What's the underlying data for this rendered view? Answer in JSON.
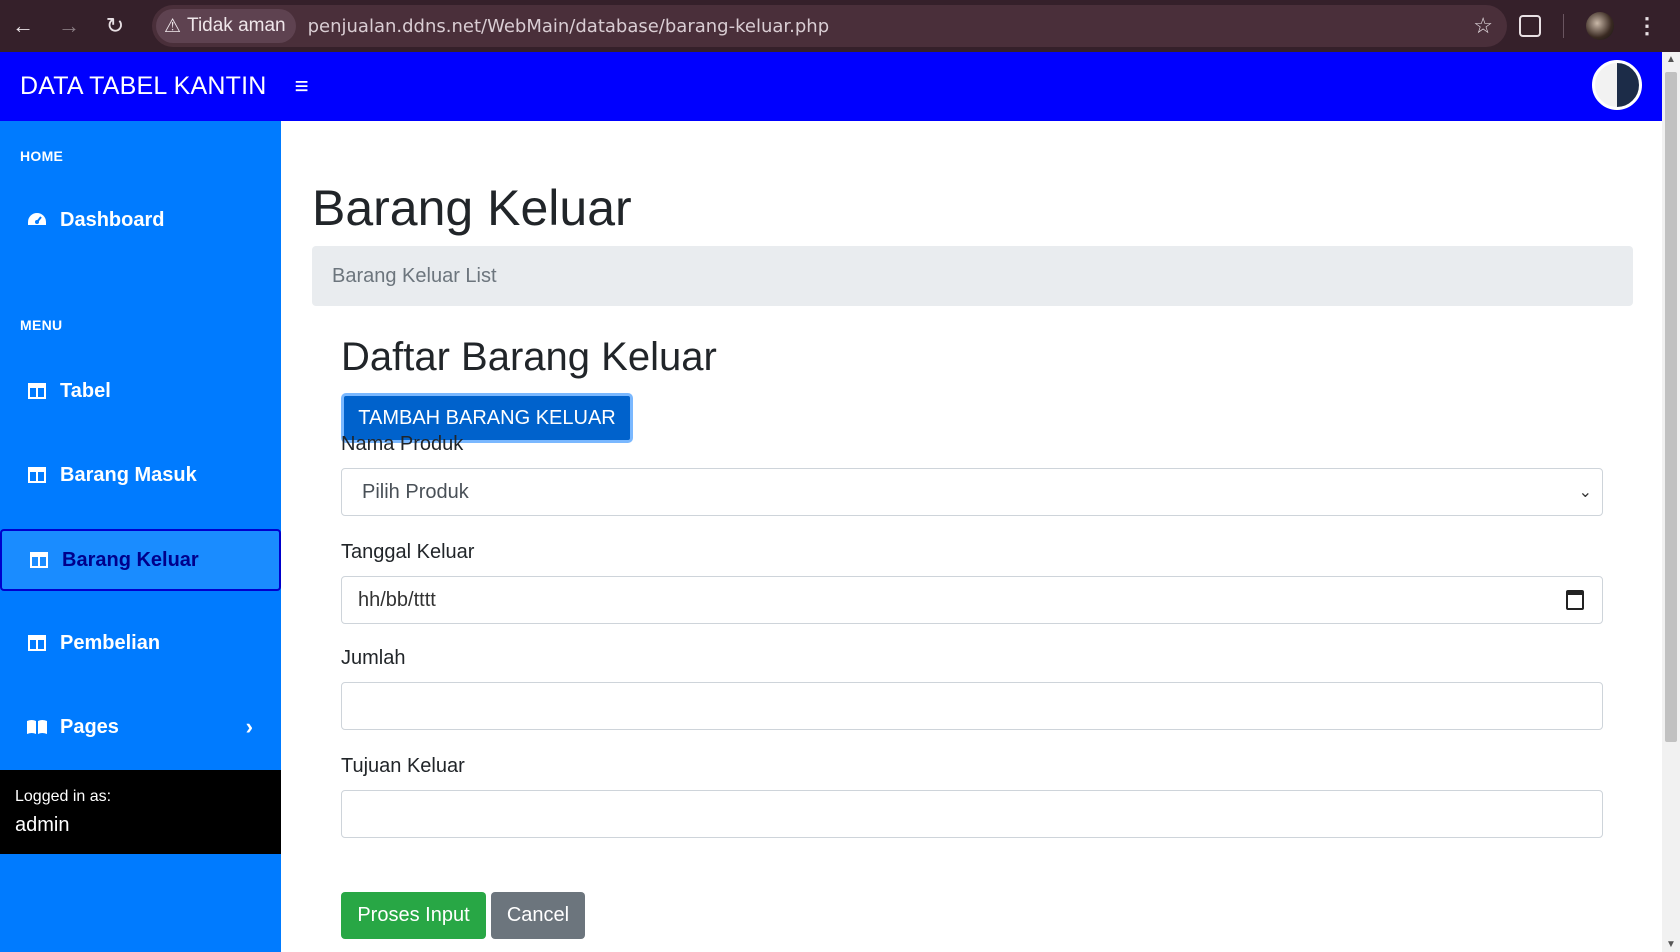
{
  "browser": {
    "security_label": "Tidak aman",
    "url": "penjualan.ddns.net/WebMain/database/barang-keluar.php"
  },
  "topbar": {
    "brand": "DATA TABEL KANTIN",
    "menu_icon": "hamburger-icon"
  },
  "sidebar": {
    "heading_home": "HOME",
    "heading_menu": "MENU",
    "items": [
      {
        "label": "Dashboard",
        "icon": "tachometer-icon"
      },
      {
        "label": "Tabel",
        "icon": "table-icon"
      },
      {
        "label": "Barang Masuk",
        "icon": "table-icon"
      },
      {
        "label": "Barang Keluar",
        "icon": "table-icon",
        "active": true
      },
      {
        "label": "Pembelian",
        "icon": "table-icon"
      },
      {
        "label": "Pages",
        "icon": "book-open-icon"
      }
    ],
    "logged_in_label": "Logged in as:",
    "username": "admin"
  },
  "main": {
    "page_title": "Barang Keluar",
    "breadcrumb": "Barang Keluar List",
    "card_title": "Daftar Barang Keluar",
    "add_button": "TAMBAH BARANG KELUAR",
    "form": {
      "nama_produk_label": "Nama Produk",
      "nama_produk_selected": "Pilih Produk",
      "tanggal_label": "Tanggal Keluar",
      "tanggal_placeholder": "hh/bb/tttt",
      "jumlah_label": "Jumlah",
      "jumlah_value": "",
      "tujuan_label": "Tujuan Keluar",
      "tujuan_value": "",
      "submit_label": "Proses Input",
      "cancel_label": "Cancel"
    }
  },
  "colors": {
    "topbar": "#0000ff",
    "sidebar": "#007bff",
    "primary_button": "#0062cc",
    "success_button": "#28a745",
    "secondary_button": "#6c757d"
  }
}
